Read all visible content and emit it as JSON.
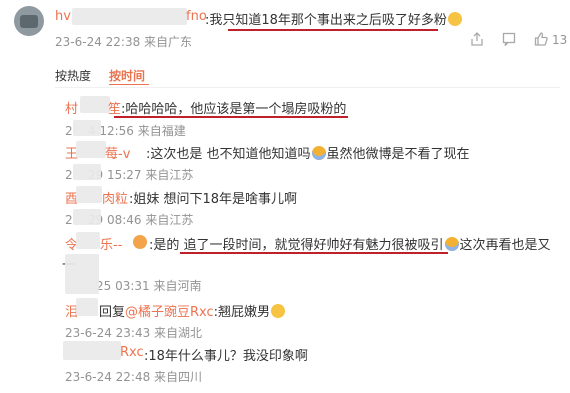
{
  "top_comment": {
    "user": "hv",
    "user_tail": "fno",
    "text": ":我只知道18年那个事出来之后吸了好多粉",
    "meta": "23-6-24 22:38 来自广东",
    "like_count": "13"
  },
  "sort_tabs": {
    "hot": "按热度",
    "time": "按时间"
  },
  "replies": [
    {
      "user": "村",
      "user_tail": "笙",
      "text": ":哈哈哈哈，他应该是第一个塌房吸粉的",
      "meta": "2    4 12:56 来自福建"
    },
    {
      "user": "王",
      "user_tail": "莓-v",
      "text": ":这次也是 也不知道他知道吗",
      "text2": "虽然他微博是不看了现在",
      "meta": "2    29 15:27 来自江苏"
    },
    {
      "user": "酉",
      "user_tail": "肉粒",
      "text": ":姐妹 想问下18年是啥事儿啊",
      "meta": "2    29 08:46 来自江苏"
    },
    {
      "user": "令",
      "user_tail": "乐--",
      "text": ":是的  追了一段时间，就觉得好帅好有魅力很被吸引",
      "text2": "这次再看也是又",
      "meta": "25 03:31 来自河南",
      "extra": "一"
    },
    {
      "user": "泪",
      "user_tail": "",
      "text": "回复",
      "mention": "@橘子豌豆Rxc",
      "text2": ":翘屁嫩男",
      "meta": "23-6-24 23:43 来自湖北"
    },
    {
      "user": "",
      "user_tail": "Rxc",
      "text": ":18年什么事儿？我没印象啊",
      "meta": "23-6-24 22:48 来自四川"
    }
  ],
  "colors": {
    "username": "#eb7350",
    "underline": "#c0202a",
    "meta": "#939393",
    "active_tab": "#eb7350"
  }
}
